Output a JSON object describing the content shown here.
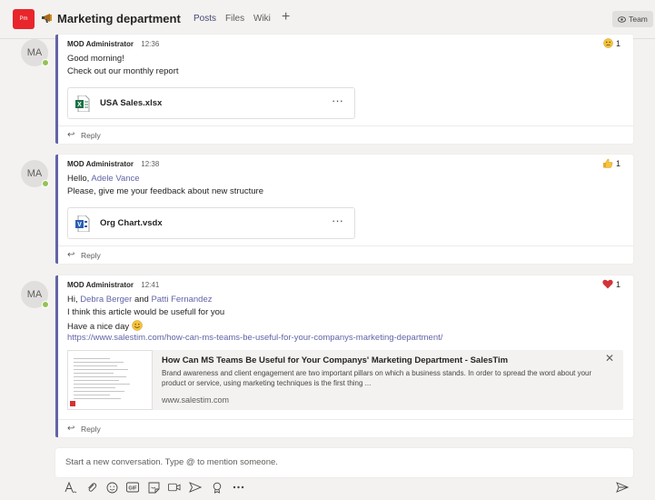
{
  "header": {
    "team_initials": "Pm",
    "channel_title": "Marketing department",
    "tabs": [
      "Posts",
      "Files",
      "Wiki"
    ],
    "active_tab": "Posts",
    "team_button": "Team",
    "brand_color": "#6264a7"
  },
  "posts": [
    {
      "initials": "MA",
      "author": "MOD Administrator",
      "time": "12:36",
      "reaction_icon": "confused-emoji",
      "reaction_count": "1",
      "lines": [
        "Good morning!",
        "Check out our monthly report"
      ],
      "attachment": {
        "name": "USA Sales.xlsx",
        "icon": "excel-file-icon",
        "more": "···"
      },
      "reply": "Reply"
    },
    {
      "initials": "MA",
      "author": "MOD Administrator",
      "time": "12:38",
      "reaction_icon": "thumbs-up-emoji",
      "reaction_count": "1",
      "greeting": "Hello,",
      "mention": "Adele Vance",
      "line2": "Please, give me your feedback about new structure",
      "attachment": {
        "name": "Org Chart.vsdx",
        "icon": "visio-file-icon",
        "more": "···"
      },
      "reply": "Reply"
    },
    {
      "initials": "MA",
      "author": "MOD Administrator",
      "time": "12:41",
      "reaction_icon": "heart-emoji",
      "reaction_count": "1",
      "greeting": "Hi,",
      "mention1": "Debra Berger",
      "conj": "and",
      "mention2": "Patti Fernandez",
      "line2": "I think this article would be usefull for you",
      "line3": "Have a nice day",
      "url": "https://www.salestim.com/how-can-ms-teams-be-useful-for-your-companys-marketing-department/",
      "preview": {
        "title": "How Can MS Teams Be Useful for Your Companys' Marketing Department - SalesTim",
        "description": "Brand awareness and client engagement are two important pillars on which a business stands. In order to spread the word about your product or service, using marketing techniques is the first thing ...",
        "domain": "www.salestim.com"
      },
      "reply": "Reply"
    }
  ],
  "compose": {
    "placeholder": "Start a new conversation. Type @ to mention someone."
  },
  "toolbar_icons": [
    "format-icon",
    "attach-icon",
    "emoji-icon",
    "gif-icon",
    "sticker-icon",
    "meet-now-icon",
    "stream-icon",
    "praise-icon",
    "more-options-icon",
    "send-icon"
  ]
}
